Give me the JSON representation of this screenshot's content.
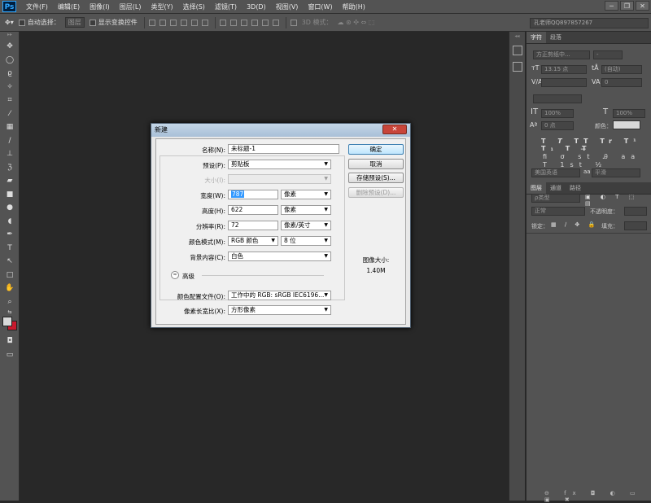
{
  "app": {
    "logo": "Ps"
  },
  "menu": [
    "文件(F)",
    "编辑(E)",
    "图像(I)",
    "图层(L)",
    "类型(Y)",
    "选择(S)",
    "滤镜(T)",
    "3D(D)",
    "视图(V)",
    "窗口(W)",
    "帮助(H)"
  ],
  "window_controls": {
    "minimize": "─",
    "restore": "❐",
    "close": "✕"
  },
  "options": {
    "auto_select": "自动选择：",
    "auto_select_target": "图层",
    "show_transform": "显示变换控件",
    "mode_3d": "3D 模式："
  },
  "user": "孔老师QQ897857267",
  "panel_character": {
    "tabs": [
      "字符",
      "段落"
    ],
    "font_family": "方正剪纸中...",
    "font_style": "-",
    "font_size": "13.15 点",
    "leading": "(自动)",
    "kerning": "",
    "tracking": "0",
    "vscale": "100%",
    "hscale": "100%",
    "baseline": "0 点",
    "color_label": "颜色：",
    "language": "美国英语",
    "antialias": "平滑",
    "aa_label": "aa"
  },
  "panel_layers": {
    "tabs": [
      "图层",
      "通道",
      "路径"
    ],
    "filter": "ρ类型",
    "blend": "正常",
    "opacity_label": "不透明度：",
    "lock_label": "锁定：",
    "fill_label": "填充："
  },
  "dialog": {
    "title": "新建",
    "close": "✕",
    "name_label": "名称(N):",
    "name_value": "未标题-1",
    "preset_label": "预设(P):",
    "preset_value": "剪贴板",
    "size_label": "大小(I):",
    "width_label": "宽度(W):",
    "width_value": "787",
    "width_unit": "像素",
    "height_label": "高度(H):",
    "height_value": "622",
    "height_unit": "像素",
    "resolution_label": "分辨率(R):",
    "resolution_value": "72",
    "resolution_unit": "像素/英寸",
    "color_mode_label": "颜色模式(M):",
    "color_mode_value": "RGB 颜色",
    "bit_depth": "8 位",
    "background_label": "背景内容(C):",
    "background_value": "白色",
    "advanced": "高级",
    "profile_label": "颜色配置文件(O):",
    "profile_value": "工作中的 RGB: sRGB IEC6196...",
    "aspect_label": "像素长宽比(X):",
    "aspect_value": "方形像素",
    "ok": "确定",
    "cancel": "取消",
    "save_preset": "存储预设(S)...",
    "delete_preset": "删除预设(D)...",
    "image_size_label": "图像大小:",
    "image_size_value": "1.40M"
  }
}
